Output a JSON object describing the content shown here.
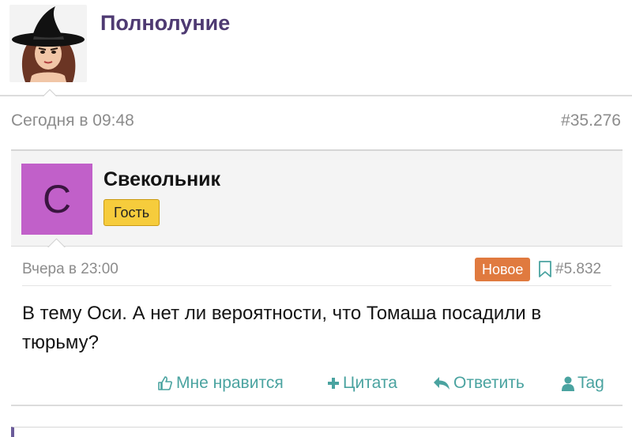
{
  "thread": {
    "poster_name": "Полнолуние",
    "post_date": "Сегодня в 09:48",
    "post_number": "#35.276"
  },
  "quote": {
    "avatar_letter": "C",
    "author": "Свекольник",
    "badge": "Гость",
    "date": "Вчера в 23:00",
    "new_label": "Новое",
    "number": "#5.832",
    "text": "В тему Оси. А нет ли вероятности, что Томаша посадили в тюрьму?"
  },
  "actions": {
    "like": "Мне нравится",
    "quote": "Цитата",
    "reply": "Ответить",
    "tag": "Tag"
  },
  "colors": {
    "poster_name": "#4e3a72",
    "avatar_bg": "#c160c9",
    "guest_badge": "#f6cc3c",
    "new_badge": "#e07a3f",
    "action_link": "#4aa3a0"
  },
  "icons": {
    "like": "thumbs-up-icon",
    "quote": "plus-icon",
    "reply": "reply-arrow-icon",
    "tag": "user-icon",
    "bookmark": "bookmark-icon"
  }
}
